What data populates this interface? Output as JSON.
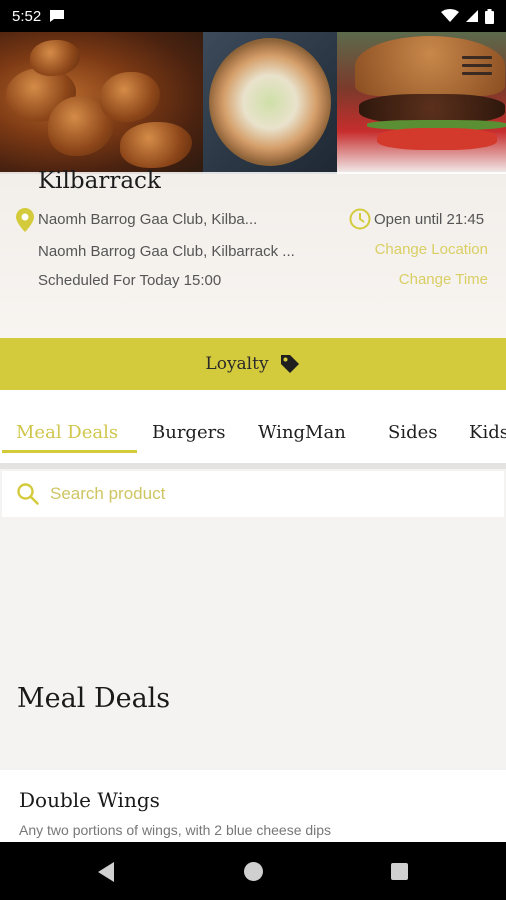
{
  "status_bar": {
    "time": "5:52",
    "icons": [
      "message-icon",
      "wifi-icon",
      "signal-icon",
      "battery-icon"
    ]
  },
  "store": {
    "name": "Kilbarrack",
    "address_short": "Naomh Barrog Gaa Club, Kilba...",
    "address_full": "Naomh Barrog Gaa Club, Kilbarrack ...",
    "schedule": "Scheduled For Today 15:00",
    "open_until": "Open until 21:45",
    "change_location": "Change Location",
    "change_time": "Change Time"
  },
  "loyalty": {
    "label": "Loyalty",
    "icon": "tag-icon"
  },
  "tabs": [
    {
      "label": "Meal Deals",
      "active": true
    },
    {
      "label": "Burgers",
      "active": false
    },
    {
      "label": "WingMan",
      "active": false
    },
    {
      "label": "Sides",
      "active": false
    },
    {
      "label": "Kids",
      "active": false
    }
  ],
  "search": {
    "placeholder": "Search product"
  },
  "section": {
    "title": "Meal Deals",
    "items": [
      {
        "name": "Double Wings",
        "description": "Any two portions of wings, with 2 blue cheese dips"
      }
    ]
  },
  "colors": {
    "accent": "#d4cb3c",
    "accent_text": "#d0c64b",
    "background": "#f4f3f1"
  }
}
